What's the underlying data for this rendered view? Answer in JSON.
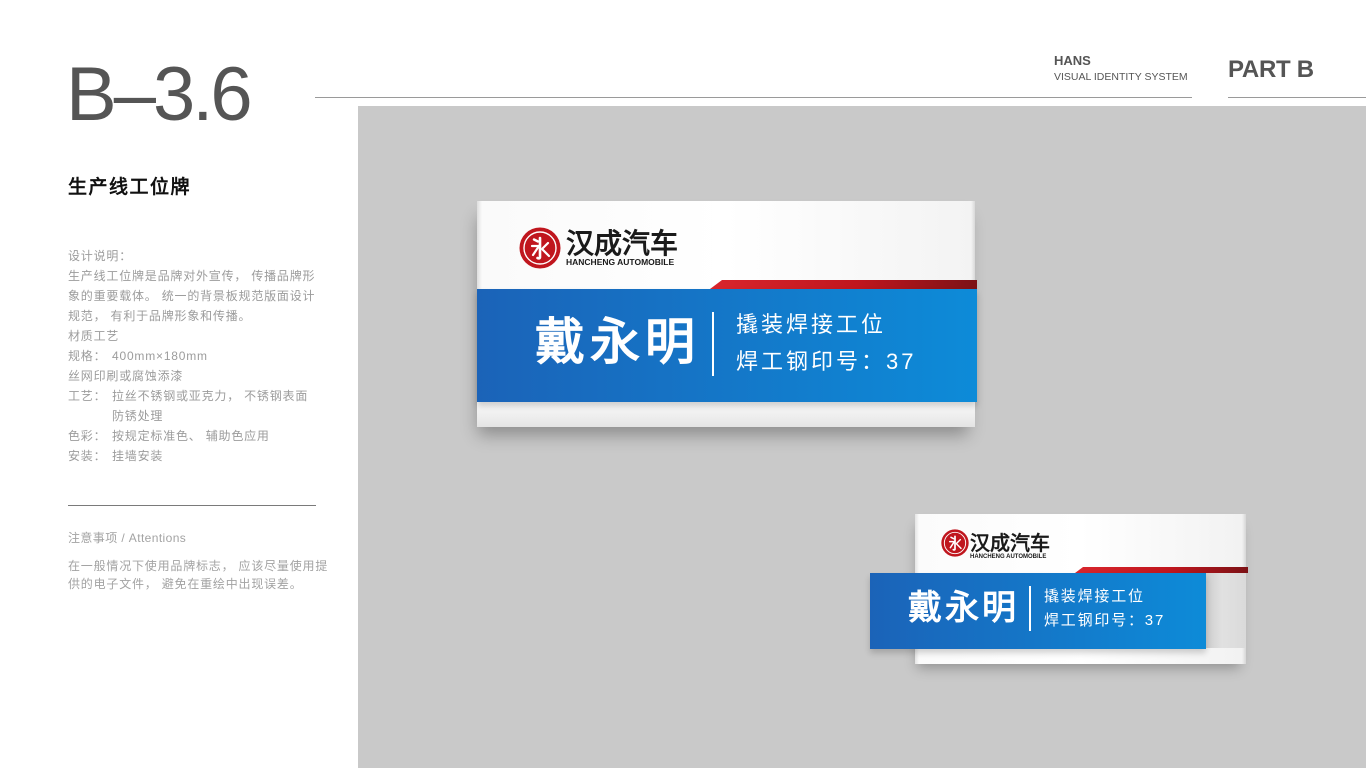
{
  "header": {
    "section_number": "B–3.6",
    "brand": "HANS",
    "system": "VISUAL IDENTITY SYSTEM",
    "part": "PART B"
  },
  "sidebar": {
    "title": "生产线工位牌",
    "intro_label": "设计说明：",
    "intro_lines": [
      "生产线工位牌是品牌对外宣传， 传播品牌形",
      "象的重要载体。 统一的背景板规范版面设计",
      "规范， 有利于品牌形象和传播。"
    ],
    "material_heading": "材质工艺",
    "spec_label": "规格：",
    "spec_value": "400mm×180mm",
    "print_method": "丝网印刷或腐蚀添漆",
    "craft_label": "工艺：",
    "craft_lines": [
      "拉丝不锈钢或亚克力， 不锈钢表面",
      "防锈处理"
    ],
    "color_label": "色彩：",
    "color_value": "按规定标准色、 辅助色应用",
    "install_label": "安装：",
    "install_value": "挂墙安装",
    "notes_title": "注意事项 / Attentions",
    "notes_lines": [
      "在一般情况下使用品牌标志， 应该尽量使用提",
      "供的电子文件， 避免在重绘中出现误差。"
    ]
  },
  "sign": {
    "logo_cn": "汉成汽车",
    "logo_en": "HANCHENG AUTOMOBILE",
    "emblem_icon": "hancheng-seal-emblem",
    "name": "戴永明",
    "station": "撬装焊接工位",
    "stamp_number": "焊工钢印号：37"
  },
  "colors": {
    "brand_red": "#c0161e",
    "brand_blue": "#1b63b8",
    "brand_blue_light": "#0d8bd8",
    "panel_gray": "#c9c9c9",
    "body_text": "#9c9c9c"
  }
}
